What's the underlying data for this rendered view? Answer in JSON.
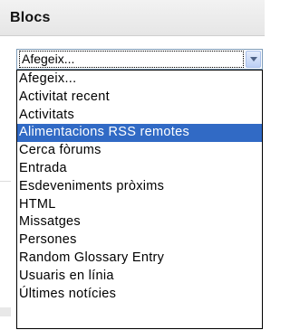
{
  "block": {
    "title": "Blocs"
  },
  "select": {
    "current_value": "Afegeix...",
    "options": [
      "Afegeix...",
      "Activitat recent",
      "Activitats",
      "Alimentacions RSS remotes",
      "Cerca fòrums",
      "Entrada",
      "Esdeveniments pròxims",
      "HTML",
      "Missatges",
      "Persones",
      "Random Glossary Entry",
      "Usuaris en línia",
      "Últimes notícies"
    ],
    "highlighted_index": 3
  },
  "colors": {
    "highlight": "#316ac5",
    "header_background": "#eeeeee"
  }
}
